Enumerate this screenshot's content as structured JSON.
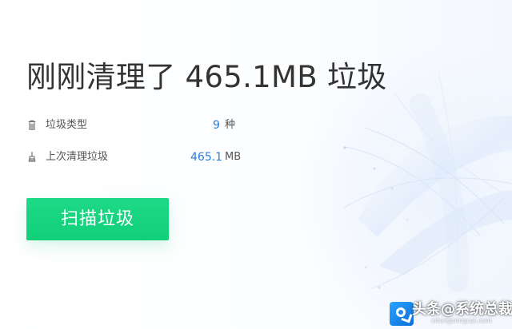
{
  "main": {
    "headline": "刚刚清理了 465.1MB 垃圾",
    "stats": [
      {
        "icon": "trash-icon",
        "label": "垃圾类型",
        "value": "9",
        "unit": "种"
      },
      {
        "icon": "broom-icon",
        "label": "上次清理垃圾",
        "value": "465.1",
        "unit": "MB"
      }
    ],
    "button_label": "扫描垃圾"
  },
  "watermark": {
    "title": "头条@系统总裁",
    "subtitle": "xitongzongcai.com",
    "logo": "system-logo-icon"
  },
  "colors": {
    "accent": "#2b7ed8",
    "button": "#15d47d",
    "text": "#333333"
  }
}
